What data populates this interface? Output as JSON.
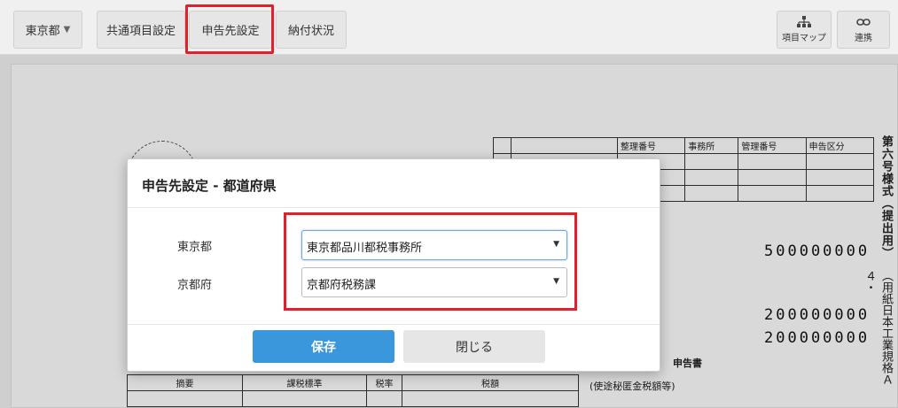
{
  "toolbar": {
    "prefecture_selector": "東京都",
    "tabs": [
      {
        "label": "共通項目設定"
      },
      {
        "label": "申告先設定"
      },
      {
        "label": "納付状況"
      }
    ],
    "map_button": "項目マップ",
    "link_button": "連携"
  },
  "document": {
    "form_title": "第六号様式（提出用）",
    "form_subtitle": "（用紙日本工業規格Ａ４・",
    "amount1": "500000000",
    "amount2": "200000000",
    "amount3": "200000000",
    "header_cells": [
      "整理番号",
      "事務所",
      "管理番号",
      "申告区分"
    ],
    "row_labels": [
      "申告書",
      "摘要",
      "課税標準",
      "税率",
      "税額"
    ],
    "note": "(使途秘匿金税額等)"
  },
  "modal": {
    "title": "申告先設定 - 都道府県",
    "rows": [
      {
        "label": "東京都",
        "value": "東京都品川都税事務所"
      },
      {
        "label": "京都府",
        "value": "京都府税務課"
      }
    ],
    "save_button": "保存",
    "close_button": "閉じる"
  },
  "colors": {
    "highlight": "#e0202a",
    "primary": "#3a97dc"
  }
}
